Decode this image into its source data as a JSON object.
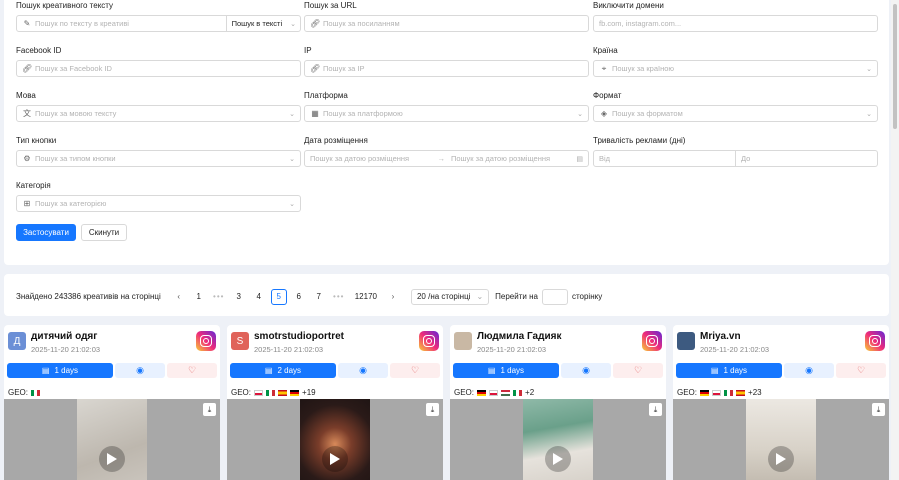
{
  "filters": {
    "text_search": {
      "label": "Пошук креативного тексту",
      "placeholder": "Пошук по тексту в креативі",
      "mode": "Пошук в тексті"
    },
    "url_search": {
      "label": "Пошук за URL",
      "placeholder": "Пошук за посиланням"
    },
    "exclude_domains": {
      "label": "Виключити домени",
      "placeholder": "fb.com, instagram.com..."
    },
    "facebook_id": {
      "label": "Facebook ID",
      "placeholder": "Пошук за Facebook ID"
    },
    "ip": {
      "label": "IP",
      "placeholder": "Пошук за IP"
    },
    "country": {
      "label": "Країна",
      "placeholder": "Пошук за країною"
    },
    "language": {
      "label": "Мова",
      "placeholder": "Пошук за мовою тексту"
    },
    "platform": {
      "label": "Платформа",
      "placeholder": "Пошук за платформою"
    },
    "format": {
      "label": "Формат",
      "placeholder": "Пошук за форматом"
    },
    "button_type": {
      "label": "Тип кнопки",
      "placeholder": "Пошук за типом кнопки"
    },
    "placement_date": {
      "label": "Дата розміщення",
      "from_placeholder": "Пошук за датою розміщення",
      "to_placeholder": "Пошук за датою розміщення"
    },
    "duration": {
      "label": "Тривалість реклами (дні)",
      "from_placeholder": "Від",
      "to_placeholder": "До"
    },
    "category": {
      "label": "Категорія",
      "placeholder": "Пошук за категорією"
    },
    "apply_label": "Застосувати",
    "reset_label": "Скинути"
  },
  "pager": {
    "found_text": "Знайдено 243386 креативів на сторінці",
    "pages": [
      "1",
      "3",
      "4",
      "5",
      "6",
      "7",
      "12170"
    ],
    "active_page": "5",
    "dots": "•••",
    "page_size": "20 /на сторінці",
    "goto_label": "Перейти на",
    "goto_suffix": "сторінку"
  },
  "cards": [
    {
      "name": "дитячий одяг",
      "date": "2025-11-20 21:02:03",
      "avatar_letter": "Д",
      "avatar_color": "#6b8fd6",
      "days": "1 days",
      "geo_label": "GEO:",
      "geo_extra": "",
      "flags": [
        "IT"
      ]
    },
    {
      "name": "smotrstudioportret",
      "date": "2025-11-20 21:02:03",
      "avatar_letter": "S",
      "avatar_color": "#e0635a",
      "days": "2 days",
      "geo_label": "GEO:",
      "geo_extra": "+19",
      "flags": [
        "PL",
        "IT",
        "ES",
        "DE"
      ]
    },
    {
      "name": "Людмила Гадияк",
      "date": "2025-11-20 21:02:03",
      "avatar_letter": "",
      "avatar_color": "#c9b8a4",
      "days": "1 days",
      "geo_label": "GEO:",
      "geo_extra": "+2",
      "flags": [
        "DE",
        "PL",
        "HU",
        "IT"
      ]
    },
    {
      "name": "Mriya.vn",
      "date": "2025-11-20 21:02:03",
      "avatar_letter": "",
      "avatar_color": "#3d5a80",
      "days": "1 days",
      "geo_label": "GEO:",
      "geo_extra": "+23",
      "flags": [
        "DE",
        "PL",
        "IT",
        "ES"
      ]
    }
  ],
  "colors": {
    "accent": "#1677ff",
    "fav_bg": "#fdeeee",
    "view_bg": "#e8f1ff"
  }
}
